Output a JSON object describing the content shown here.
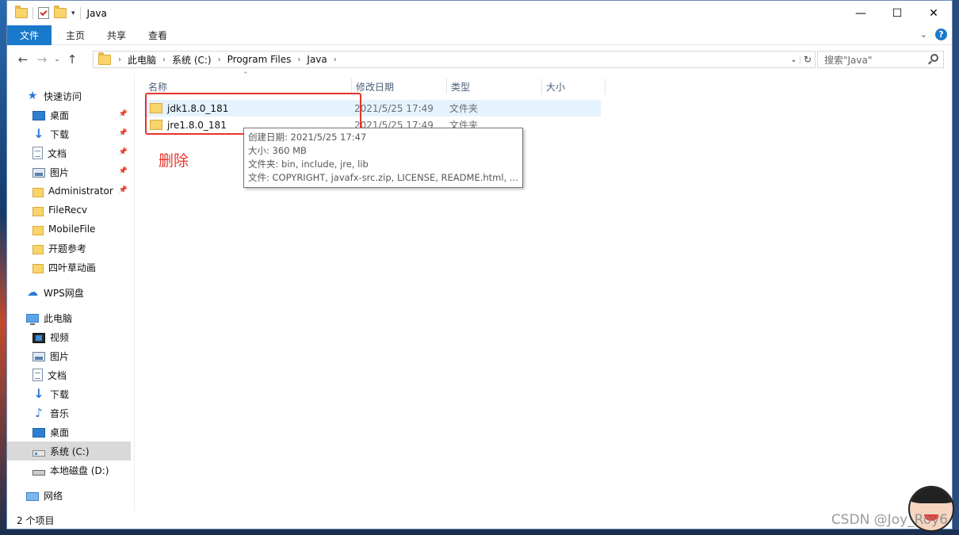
{
  "window": {
    "title": "Java",
    "controls": {
      "minimize": "—",
      "maximize": "☐",
      "close": "✕"
    }
  },
  "ribbon": {
    "tabs": [
      "文件",
      "主页",
      "共享",
      "查看"
    ]
  },
  "nav": {
    "back": "←",
    "forward": "→",
    "recent": "⌄",
    "up": "↑"
  },
  "address": {
    "crumbs": [
      "此电脑",
      "系统 (C:)",
      "Program Files",
      "Java"
    ]
  },
  "search": {
    "placeholder": "搜索\"Java\""
  },
  "sidebar": {
    "items": [
      {
        "label": "快速访问",
        "icon": "star-icon",
        "level": 0,
        "pinned": false
      },
      {
        "label": "桌面",
        "icon": "desktop-icon",
        "level": 1,
        "pinned": true
      },
      {
        "label": "下载",
        "icon": "download-icon",
        "level": 1,
        "pinned": true
      },
      {
        "label": "文档",
        "icon": "document-icon",
        "level": 1,
        "pinned": true
      },
      {
        "label": "图片",
        "icon": "pictures-icon",
        "level": 1,
        "pinned": true
      },
      {
        "label": "Administrator",
        "icon": "folder-icon",
        "level": 1,
        "pinned": true
      },
      {
        "label": "FileRecv",
        "icon": "folder-icon",
        "level": 1,
        "pinned": false
      },
      {
        "label": "MobileFile",
        "icon": "folder-icon",
        "level": 1,
        "pinned": false
      },
      {
        "label": "开题参考",
        "icon": "folder-icon",
        "level": 1,
        "pinned": false
      },
      {
        "label": "四叶草动画",
        "icon": "folder-icon",
        "level": 1,
        "pinned": false
      },
      {
        "label": "WPS网盘",
        "icon": "cloud-icon",
        "level": 0,
        "pinned": false
      },
      {
        "label": "此电脑",
        "icon": "computer-icon",
        "level": 0,
        "pinned": false
      },
      {
        "label": "视频",
        "icon": "video-icon",
        "level": 1,
        "pinned": false
      },
      {
        "label": "图片",
        "icon": "pictures-icon",
        "level": 1,
        "pinned": false
      },
      {
        "label": "文档",
        "icon": "document-icon",
        "level": 1,
        "pinned": false
      },
      {
        "label": "下载",
        "icon": "download-icon",
        "level": 1,
        "pinned": false
      },
      {
        "label": "音乐",
        "icon": "music-icon",
        "level": 1,
        "pinned": false
      },
      {
        "label": "桌面",
        "icon": "desktop-icon",
        "level": 1,
        "pinned": false
      },
      {
        "label": "系统 (C:)",
        "icon": "drive-icon",
        "level": 1,
        "pinned": false,
        "selected": true
      },
      {
        "label": "本地磁盘 (D:)",
        "icon": "drive-icon",
        "level": 1,
        "pinned": false
      },
      {
        "label": "网络",
        "icon": "network-icon",
        "level": 0,
        "pinned": false
      }
    ]
  },
  "filelist": {
    "columns": [
      "名称",
      "修改日期",
      "类型",
      "大小"
    ],
    "rows": [
      {
        "name": "jdk1.8.0_181",
        "date": "2021/5/25 17:49",
        "type": "文件夹",
        "size": ""
      },
      {
        "name": "jre1.8.0_181",
        "date": "2021/5/25 17:49",
        "type": "文件夹",
        "size": ""
      }
    ]
  },
  "tooltip": {
    "lines": [
      "创建日期: 2021/5/25 17:47",
      "大小: 360 MB",
      "文件夹: bin, include, jre, lib",
      "文件: COPYRIGHT, javafx-src.zip, LICENSE, README.html, ..."
    ]
  },
  "annotation": {
    "text": "删除",
    "color": "#e8332a"
  },
  "status": {
    "count": "2 个项目"
  },
  "watermark": "CSDN @Joy_Roy6",
  "colors": {
    "accent": "#1979ca",
    "selection": "#e5f3ff",
    "annotation": "#e8332a"
  }
}
